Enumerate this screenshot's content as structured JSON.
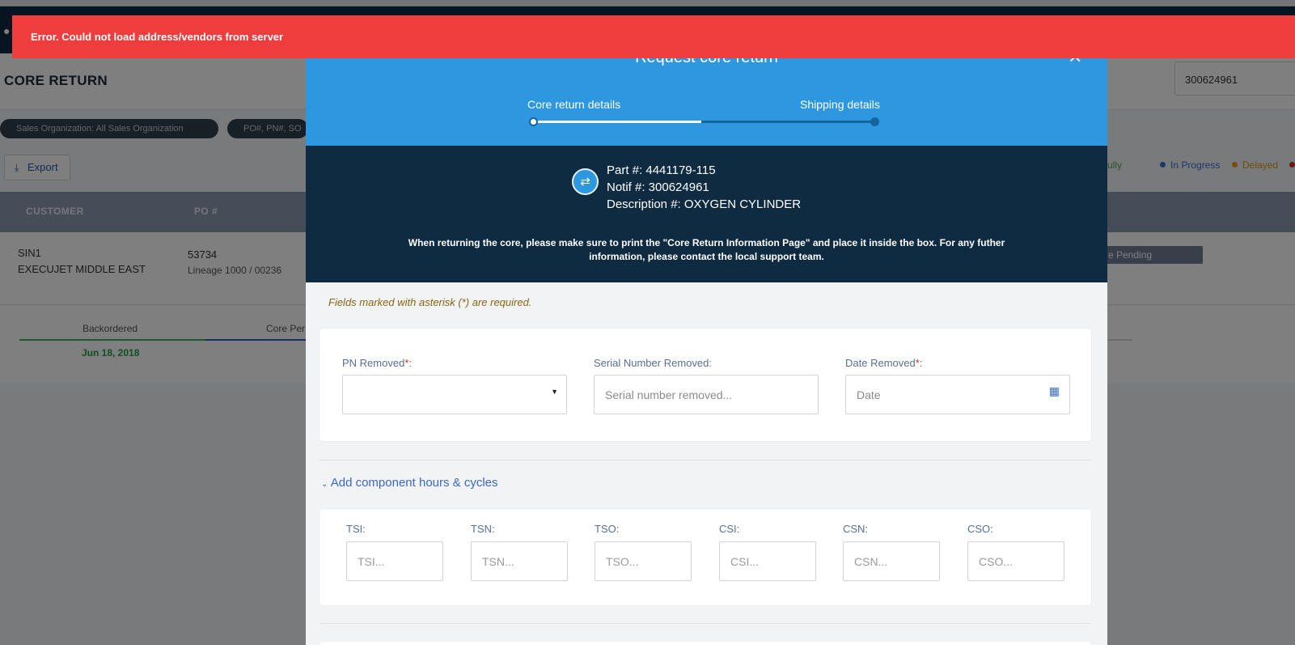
{
  "background": {
    "page_title": "CORE RETURN",
    "search_value": "300624961",
    "filters": [
      "Sales Organization: All Sales Organization",
      "PO#, PN#, SO"
    ],
    "export_label": "Export",
    "legend": [
      {
        "label": "ccessfully",
        "color": "#4caf50"
      },
      {
        "label": "In Progress",
        "color": "#3a6fd8"
      },
      {
        "label": "Delayed",
        "color": "#f39c12"
      }
    ],
    "table_headers": [
      "CUSTOMER",
      "PO #"
    ],
    "row": {
      "customer_code": "SIN1",
      "customer_name": "EXECUJET MIDDLE EAST",
      "po": "53734",
      "po_sub": "Lineage 1000 / 00236",
      "status": "e Pending"
    },
    "timeline": {
      "step1": "Backordered",
      "step1_date": "Jun 18, 2018",
      "step2": "Core Per"
    }
  },
  "toast": {
    "message": "Error. Could not load address/vendors from server"
  },
  "modal": {
    "title": "Request core return",
    "steps": [
      "Core return details",
      "Shipping details"
    ],
    "part": {
      "part_line": "Part #: 4441179-115",
      "notif_line": "Notif #: 300624961",
      "desc_line": "Description #: OXYGEN CYLINDER"
    },
    "notice": "When returning the core, please make sure to print the \"Core Return Information Page\" and place it inside the box. For any futher information, please contact the local support team.",
    "required_note": "Fields marked with asterisk (*) are required.",
    "fields": {
      "pn_removed": {
        "label": "PN Removed",
        "value": ""
      },
      "serial_removed": {
        "label": "Serial Number Removed:",
        "placeholder": "Serial number removed..."
      },
      "date_removed": {
        "label": "Date Removed",
        "placeholder": "Date"
      }
    },
    "asterisk": "*",
    "colon": ":",
    "toggle_label": "Add component hours & cycles",
    "hours": [
      {
        "label": "TSI:",
        "placeholder": "TSI..."
      },
      {
        "label": "TSN:",
        "placeholder": "TSN..."
      },
      {
        "label": "TSO:",
        "placeholder": "TSO..."
      },
      {
        "label": "CSI:",
        "placeholder": "CSI..."
      },
      {
        "label": "CSN:",
        "placeholder": "CSN..."
      },
      {
        "label": "CSO:",
        "placeholder": "CSO..."
      }
    ]
  },
  "colors": {
    "accent": "#2d97e0",
    "info_bg": "#0f2b42",
    "error": "#ef3d3d"
  }
}
